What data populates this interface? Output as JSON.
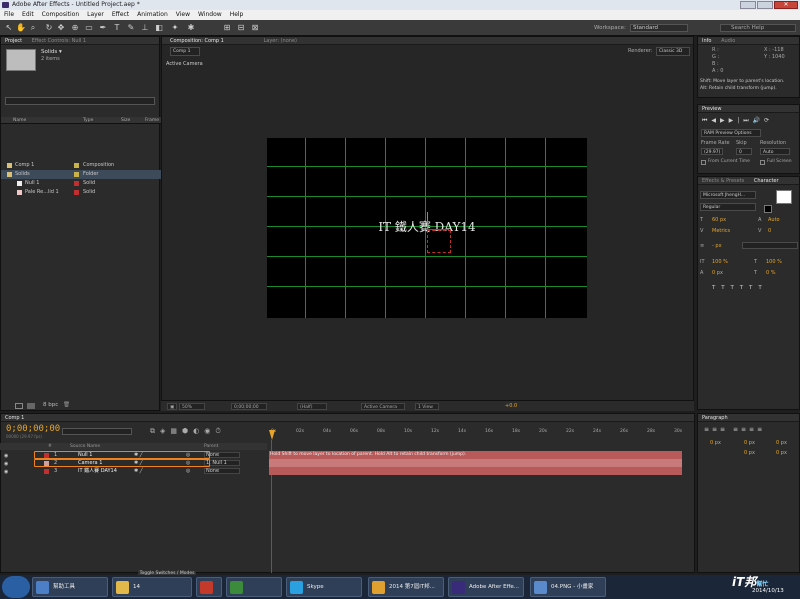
{
  "window": {
    "title": "Adobe After Effects - Untitled Project.aep *"
  },
  "menu": [
    "File",
    "Edit",
    "Composition",
    "Layer",
    "Effect",
    "Animation",
    "View",
    "Window",
    "Help"
  ],
  "toolbar": {
    "workspace_label": "Workspace:",
    "workspace_value": "Standard",
    "search_placeholder": "Search Help"
  },
  "project": {
    "tabs": [
      "Project",
      "Effect Controls: Null 1"
    ],
    "selected_name": "Solids ▾",
    "selected_count": "2 items",
    "columns": [
      "Name",
      "Type",
      "Size",
      "Frame"
    ],
    "rows": [
      {
        "name": "Comp 1",
        "type": "Composition",
        "size": "",
        "color": "#c7b24b",
        "indent": 0,
        "icon": "comp"
      },
      {
        "name": "Solids",
        "type": "Folder",
        "size": "",
        "color": "#c7b24b",
        "indent": 0,
        "icon": "folder",
        "selected": true
      },
      {
        "name": "Null 1",
        "type": "Solid",
        "size": "",
        "color": "#c03030",
        "indent": 1,
        "icon": "solid"
      },
      {
        "name": "Pale Re...lid 1",
        "type": "Solid",
        "size": "",
        "color": "#c03030",
        "indent": 1,
        "icon": "solid-pink"
      }
    ],
    "bpc": "8 bpc"
  },
  "composition": {
    "tabs": [
      "Composition: Comp 1",
      "Layer: (none)"
    ],
    "sub_tab": "Comp 1",
    "renderer_label": "Renderer:",
    "renderer_value": "Classic 3D",
    "view_label": "Active Camera",
    "text": "IT 鐵人賽 DAY14",
    "bottom": {
      "zoom": "50%",
      "time": "0;00;00;00",
      "resolution": "(Half)",
      "camera": "Active Camera",
      "views": "1 View",
      "offset": "+0.0"
    }
  },
  "info": {
    "tabs": [
      "Info",
      "Audio"
    ],
    "r": "R :",
    "g": "G :",
    "b": "B :",
    "a": "A : 0",
    "x": "X : -118",
    "y": "Y : 1040",
    "msg1": "Shift: Move layer to parent's location.",
    "msg2": "Alt: Retain child transform (jump)."
  },
  "preview": {
    "tab": "Preview",
    "ram": "RAM Preview Options",
    "framerate_label": "Frame Rate",
    "skip_label": "Skip",
    "resolution_label": "Resolution",
    "framerate": "(29.97)",
    "skip": "0",
    "resolution": "Auto",
    "from_current": "From Current Time",
    "full_screen": "Full Screen"
  },
  "character": {
    "tabs": [
      "Effects & Presets",
      "Character"
    ],
    "font": "Microsoft JhengH...",
    "style": "Regular",
    "size": "60 px",
    "leading": "Auto",
    "kerning": "Metrics",
    "tracking": "0",
    "stroke": "- px",
    "vscale": "100 %",
    "hscale": "100 %",
    "baseline": "0 px",
    "tsume": "0 %"
  },
  "paragraph": {
    "tab": "Paragraph",
    "v1": "0 px",
    "v2": "0 px",
    "v3": "0 px",
    "v4": "0 px",
    "v5": "0 px"
  },
  "timeline": {
    "tab": "Comp 1",
    "timecode": "0;00;00;00",
    "fps": "00000 (29.97 fps)",
    "columns": [
      "#",
      "Source Name",
      "Parent"
    ],
    "layers": [
      {
        "num": "1",
        "name": "Null 1",
        "parent": "None",
        "label": "#c03030",
        "highlight": true,
        "bar": "#b85a5a"
      },
      {
        "num": "2",
        "name": "Camera 1",
        "parent": "1. Null 1",
        "label": "#d0a0a0",
        "highlight": true,
        "bar": "#c87a7a"
      },
      {
        "num": "3",
        "name": "IT 鐵人賽 DAY14",
        "parent": "None",
        "label": "#c03030",
        "highlight": false,
        "bar": "#b85a5a"
      }
    ],
    "ruler": [
      "0s",
      "02s",
      "04s",
      "06s",
      "08s",
      "10s",
      "12s",
      "14s",
      "16s",
      "18s",
      "20s",
      "22s",
      "24s",
      "26s",
      "28s",
      "30s"
    ],
    "hint": "Hold Shift to move layer to location of parent. Hold Alt to retain child transform (jump).",
    "toggle": "Toggle Switches / Modes"
  },
  "taskbar": {
    "items": [
      {
        "label": "幫助工具",
        "color": "#4d7fc7"
      },
      {
        "label": "14",
        "color": "#e2b84a"
      },
      {
        "label": "",
        "color": "#c43a2a"
      },
      {
        "label": "",
        "color": "#3c8a3c"
      },
      {
        "label": "Skype",
        "color": "#2ba0e0"
      },
      {
        "label": "2014 第7屆iT邦...",
        "color": "#e0a030"
      },
      {
        "label": "Adobe After Effe...",
        "color": "#3a2a7a"
      },
      {
        "label": "04.PNG - 小畫家",
        "color": "#5a8acb"
      }
    ],
    "date": "2014/10/13",
    "watermark": "iT邦",
    "watermark_sub": "幫忙"
  }
}
